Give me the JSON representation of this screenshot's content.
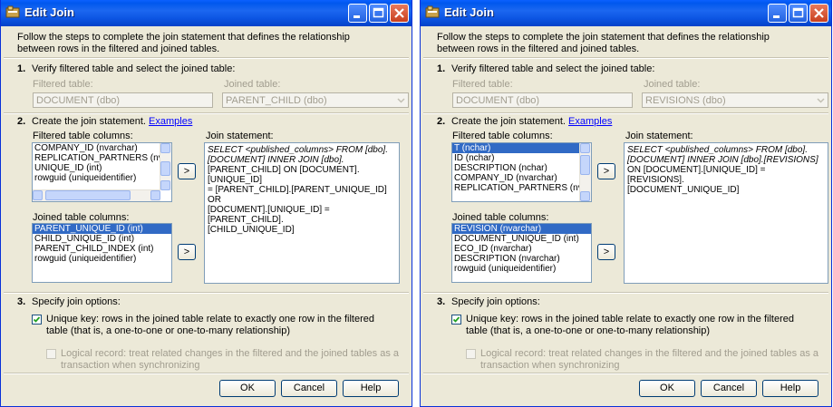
{
  "dialog_title": "Edit Join",
  "intro": "Follow the steps to complete the join statement that defines the relationship between rows in the filtered and joined tables.",
  "step1": {
    "num": "1.",
    "text": "Verify filtered table and select the joined table:"
  },
  "filtered_table_label": "Filtered table:",
  "joined_table_label": "Joined table:",
  "step2": {
    "num": "2.",
    "text": "Create the join statement.",
    "link": "Examples"
  },
  "filtered_cols_label": "Filtered table columns:",
  "joined_cols_label": "Joined table columns:",
  "join_statement_label": "Join statement:",
  "step3": {
    "num": "3.",
    "text": "Specify join options:"
  },
  "unique_key_text": "Unique key: rows in the joined table relate to exactly one row in the filtered table (that is, a one-to-one or one-to-many relationship)",
  "logical_record_text": "Logical record: treat related changes in the filtered and the joined tables as a transaction when synchronizing",
  "buttons": {
    "ok": "OK",
    "cancel": "Cancel",
    "help": "Help",
    "add": ">"
  },
  "left": {
    "filtered_table": "DOCUMENT (dbo)",
    "joined_table": "PARENT_CHILD (dbo)",
    "filtered_columns": [
      "COMPANY_ID (nvarchar)",
      "REPLICATION_PARTNERS (nvarcha",
      "UNIQUE_ID (int)",
      "rowguid (uniqueidentifier)"
    ],
    "joined_columns": [
      "PARENT_UNIQUE_ID (int)",
      "CHILD_UNIQUE_ID (int)",
      "PARENT_CHILD_INDEX (int)",
      "rowguid (uniqueidentifier)"
    ],
    "join_lines": [
      "SELECT <published_columns> FROM [dbo].",
      "[DOCUMENT] INNER JOIN [dbo].",
      "[PARENT_CHILD] ON [DOCUMENT].[UNIQUE_ID]",
      "= [PARENT_CHILD].[PARENT_UNIQUE_ID] OR",
      "[DOCUMENT].[UNIQUE_ID] = [PARENT_CHILD].",
      "[CHILD_UNIQUE_ID]"
    ]
  },
  "right": {
    "filtered_table": "DOCUMENT (dbo)",
    "joined_table": "REVISIONS (dbo)",
    "filtered_columns": [
      "T (nchar)",
      "ID (nchar)",
      "DESCRIPTION (nchar)",
      "COMPANY_ID (nvarchar)",
      "REPLICATION_PARTNERS (nvarch"
    ],
    "joined_columns": [
      "REVISION (nvarchar)",
      "DOCUMENT_UNIQUE_ID (int)",
      "ECO_ID (nvarchar)",
      "DESCRIPTION (nvarchar)",
      "rowguid (uniqueidentifier)"
    ],
    "join_lines": [
      "SELECT <published_columns> FROM [dbo].",
      "[DOCUMENT] INNER JOIN [dbo].[REVISIONS]",
      "ON [DOCUMENT].[UNIQUE_ID] = [REVISIONS].",
      "[DOCUMENT_UNIQUE_ID]"
    ]
  },
  "colors": {
    "titlebar": "#0058ee",
    "selection": "#316ac5",
    "dialog_bg": "#ece9d8",
    "link": "#0000ff"
  },
  "icons": [
    "app-icon",
    "minimize-icon",
    "maximize-icon",
    "close-icon",
    "checkbox-checked-icon",
    "dropdown-arrow-icon"
  ]
}
